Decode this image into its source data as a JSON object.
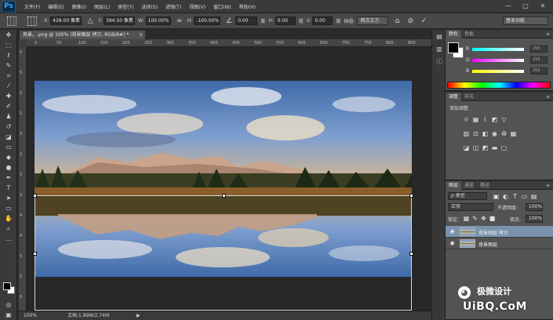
{
  "app": {
    "logo": "Ps",
    "menu": [
      "文件(F)",
      "编辑(E)",
      "图像(I)",
      "图层(L)",
      "类型(Y)",
      "选择(S)",
      "滤镜(T)",
      "视图(V)",
      "窗口(W)",
      "帮助(H)"
    ],
    "window_buttons": [
      "—",
      "□",
      "✕"
    ]
  },
  "options": {
    "x_label": "X:",
    "x_value": "428.00 像素",
    "y_label": "Y:",
    "y_value": "394.50 像素",
    "w_label": "W:",
    "w_value": "100.00%",
    "h_label": "H:",
    "h_value": "-100.00%",
    "angle_value": "0.00",
    "angle_unit": "度",
    "hskew_label": "H:",
    "hskew_value": "0.00",
    "hskew_unit": "度",
    "vskew_label": "V:",
    "vskew_value": "0.00",
    "vskew_unit": "度",
    "interp_label": "插值:",
    "interp_value": "两次立方",
    "workspace": "基本功能"
  },
  "document": {
    "tab_title": "风景。.png @ 100% (背景图层 拷贝, RGB/8#) *",
    "ruler_h": [
      "0",
      "50",
      "100",
      "150",
      "200",
      "250",
      "300",
      "350",
      "400",
      "450",
      "500",
      "550",
      "600",
      "650",
      "700",
      "750",
      "800",
      "850"
    ],
    "ruler_v": [
      "0",
      "5",
      "1",
      "1",
      "2",
      "2",
      "3",
      "3",
      "4",
      "4",
      "5",
      "5",
      "6"
    ]
  },
  "status": {
    "zoom": "100%",
    "doc_info": "文档:1.89M/2.74M",
    "arrow": "▶"
  },
  "panels": {
    "color": {
      "tabs": [
        "颜色",
        "色板"
      ],
      "r_label": "R",
      "g_label": "G",
      "b_label": "B",
      "r_value": "255",
      "g_value": "255",
      "b_value": "255"
    },
    "adjustments": {
      "tabs": [
        "调整",
        "样式"
      ],
      "title": "添加调整"
    },
    "layers": {
      "tabs": [
        "图层",
        "通道",
        "路径"
      ],
      "kind_placeholder": "ρ 类型",
      "blend_mode": "正常",
      "opacity_label": "不透明度:",
      "opacity_value": "100%",
      "lock_label": "锁定:",
      "fill_label": "填充:",
      "fill_value": "100%",
      "items": [
        {
          "name": "背景图层 拷贝",
          "selected": true
        },
        {
          "name": "背景图层",
          "selected": false
        }
      ]
    }
  },
  "watermark": {
    "brand_text": "极微设计",
    "url": "UiBQ.CoM"
  }
}
